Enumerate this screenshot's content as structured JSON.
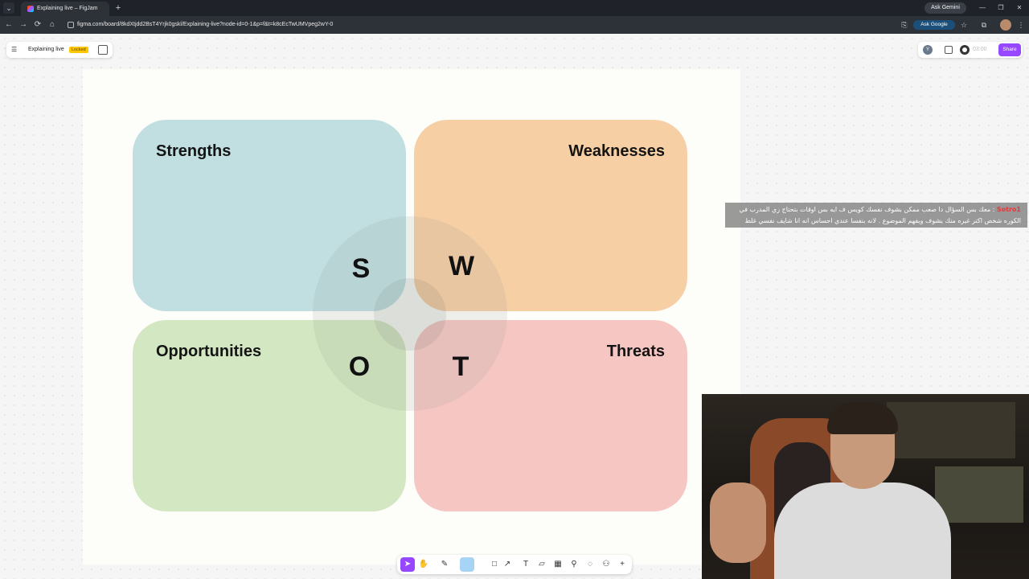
{
  "browser": {
    "tab_title": "Explaining live – FigJam",
    "tab_list_glyph": "⌄",
    "tab_close_glyph": "✕",
    "new_tab_glyph": "+",
    "ask_gemini_label": "Ask Gemini",
    "window_controls": {
      "minimize": "—",
      "maximize": "❐",
      "close": "✕"
    },
    "nav": {
      "back": "←",
      "forward": "→",
      "reload": "⟳",
      "home": "⌂"
    },
    "url": "figma.com/board/8kdXtjdd2BsT4Yrjk0gskl/Explaining-live?node-id=0-1&p=f&t=k8cEcTwUMVpeg2wY-0",
    "ask_google_label": "Ask Google",
    "star_glyph": "☆",
    "extensions_glyph": "⧉",
    "more_glyph": "⋮",
    "save_glyph": "⎘"
  },
  "figjam": {
    "menu_glyph": "☰",
    "file_name": "Explaining live",
    "locked_label": "Locked",
    "user_initial": "Y",
    "timer_text": "03:00",
    "share_label": "Share"
  },
  "swot": {
    "strengths_title": "Strengths",
    "weaknesses_title": "Weaknesses",
    "opportunities_title": "Opportunities",
    "threats_title": "Threats",
    "letter_s": "S",
    "letter_w": "W",
    "letter_o": "O",
    "letter_t": "T",
    "colors": {
      "strengths": "#c1dfe1",
      "weaknesses": "#f7cfa5",
      "opportunities": "#d3e8c2",
      "threats": "#f6c6c3"
    }
  },
  "caption": {
    "name": "Sotro1",
    "text": ": معك بس السؤال دا صعب ممكن بشوف نفسك كويس ف ايه بس اوقات بتحتاج زي المدرب في الكوره شخص اكتر غيره منك يشوف ويفهم الموضوع . لانه بنفسا عندي احساس انه انا شايف نفسي غلط"
  },
  "toolbar": {
    "select": "➤",
    "hand": "✋",
    "marker": "✎",
    "shape": "□",
    "connector": "↗",
    "text": "T",
    "sticky": "▱",
    "table": "▦",
    "stamp": "⚲",
    "comment": "◌",
    "widgets": "⚇",
    "more": "+"
  }
}
